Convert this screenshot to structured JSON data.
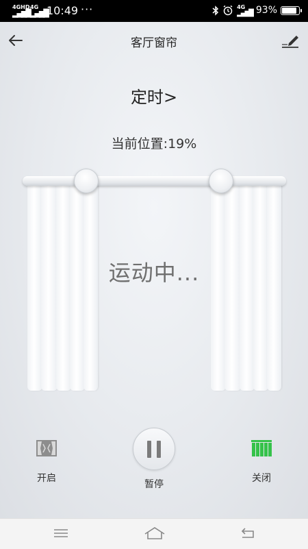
{
  "status_bar": {
    "sim1": "4GHD",
    "sim2": "4G",
    "time": "10:49",
    "more": "···",
    "net": "4G",
    "battery": "93%",
    "battery_level": 0.93
  },
  "header": {
    "title": "客厅窗帘",
    "back_icon": "arrow-left-icon",
    "edit_icon": "pencil-icon"
  },
  "timer": {
    "label": "定时",
    "chevron": ">"
  },
  "position": {
    "label": "当前位置:19%",
    "value": 19
  },
  "curtain": {
    "status": "运动中..."
  },
  "controls": {
    "open": {
      "label": "开启",
      "icon": "curtain-open-icon"
    },
    "pause": {
      "label": "暂停",
      "icon": "pause-icon"
    },
    "close": {
      "label": "关闭",
      "icon": "curtain-close-icon",
      "color": "#35c24a"
    }
  },
  "nav": {
    "menu_icon": "menu-icon",
    "home_icon": "home-icon",
    "back_icon": "back-icon"
  }
}
